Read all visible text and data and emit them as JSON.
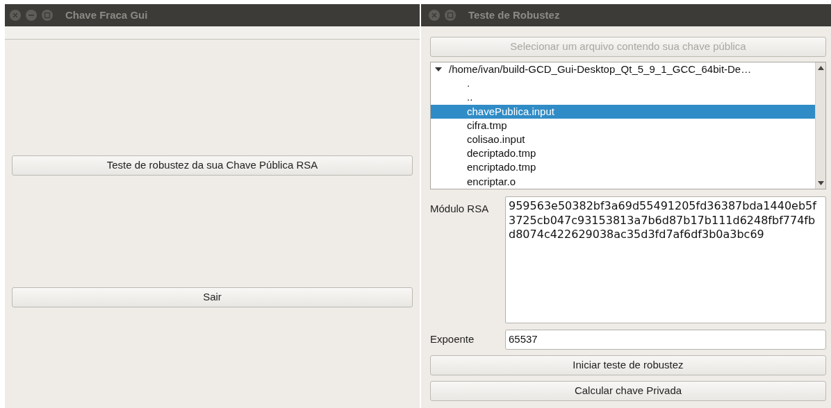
{
  "main_window": {
    "title": "Chave Fraca Gui",
    "buttons": [
      {
        "label": "Teste de robustez da sua Chave Pública RSA"
      },
      {
        "label": "Sair"
      }
    ]
  },
  "dialog": {
    "title": "Teste de Robustez",
    "select_file_button": {
      "label": "Selecionar um arquivo contendo sua chave pública",
      "disabled": true
    },
    "file_tree": {
      "root": {
        "label": "/home/ivan/build-GCD_Gui-Desktop_Qt_5_9_1_GCC_64bit-De…",
        "expanded": true,
        "children": [
          {
            "label": ".",
            "selected": false
          },
          {
            "label": "..",
            "selected": false
          },
          {
            "label": "chavePublica.input",
            "selected": true
          },
          {
            "label": "cifra.tmp",
            "selected": false
          },
          {
            "label": "colisao.input",
            "selected": false
          },
          {
            "label": "decriptado.tmp",
            "selected": false
          },
          {
            "label": "encriptado.tmp",
            "selected": false
          },
          {
            "label": "encriptar.o",
            "selected": false
          }
        ]
      }
    },
    "modulus": {
      "label": "Módulo RSA",
      "value": "959563e50382bf3a69d55491205fd36387bda1440eb5f3725cb047c93153813a7b6d87b17b111d6248fbf774fbd8074c422629038ac35d3fd7af6df3b0a3bc69"
    },
    "exponent": {
      "label": "Expoente",
      "value": "65537"
    },
    "buttons": [
      {
        "label": "Iniciar teste de robustez"
      },
      {
        "label": "Calcular chave Privada"
      }
    ]
  }
}
